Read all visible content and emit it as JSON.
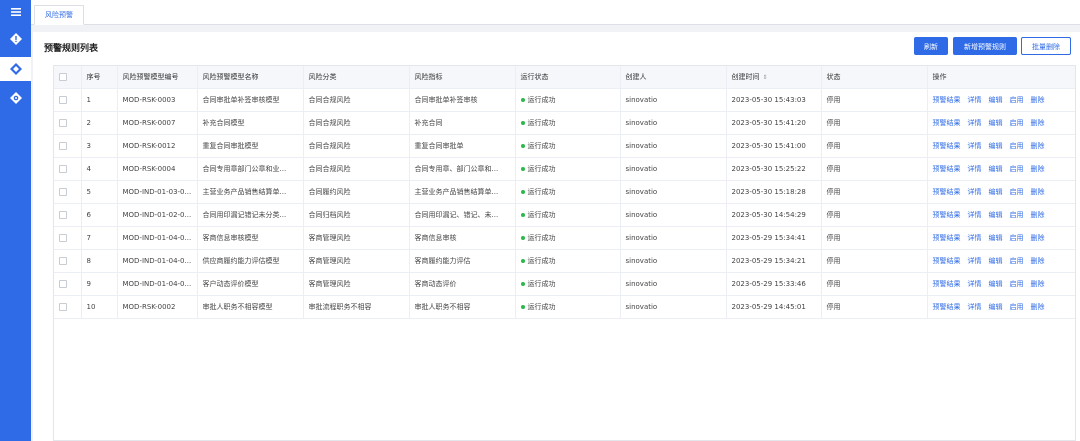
{
  "sidebar": {
    "icons": [
      "menu-icon",
      "warning-diamond-icon",
      "risk-diamond-icon",
      "settings-diamond-icon"
    ]
  },
  "tab": {
    "label": "风险预警"
  },
  "page": {
    "title": "预警规则列表",
    "buttons": {
      "refresh": "刷新",
      "add": "新增预警规则",
      "batch_delete": "批量删除"
    }
  },
  "table": {
    "headers": {
      "index": "序号",
      "code": "风险预警模型编号",
      "name": "风险预警模型名称",
      "category": "风险分类",
      "indicator": "风险指标",
      "run_status": "运行状态",
      "creator": "创建人",
      "created_at": "创建时间",
      "status": "状态",
      "actions": "操作"
    },
    "action_labels": [
      "预警结果",
      "详情",
      "编辑",
      "启用",
      "删除"
    ],
    "rows": [
      {
        "index": "1",
        "code": "MOD-RSK-0003",
        "name": "合同审批单补签审核模型",
        "category": "合同合规风险",
        "indicator": "合同审批单补签审核",
        "run_status": "运行成功",
        "creator": "sinovatio",
        "created_at": "2023-05-30 15:43:03",
        "status": "停用"
      },
      {
        "index": "2",
        "code": "MOD-RSK-0007",
        "name": "补充合同模型",
        "category": "合同合规风险",
        "indicator": "补充合同",
        "run_status": "运行成功",
        "creator": "sinovatio",
        "created_at": "2023-05-30 15:41:20",
        "status": "停用"
      },
      {
        "index": "3",
        "code": "MOD-RSK-0012",
        "name": "重复合同审批模型",
        "category": "合同合规风险",
        "indicator": "重复合同审批单",
        "run_status": "运行成功",
        "creator": "sinovatio",
        "created_at": "2023-05-30 15:41:00",
        "status": "停用"
      },
      {
        "index": "4",
        "code": "MOD-RSK-0004",
        "name": "合同专用章部门公章和业...",
        "category": "合同合规风险",
        "indicator": "合同专用章、部门公章和...",
        "run_status": "运行成功",
        "creator": "sinovatio",
        "created_at": "2023-05-30 15:25:22",
        "status": "停用"
      },
      {
        "index": "5",
        "code": "MOD-IND-01-03-0...",
        "name": "主营业务产品销售结算单...",
        "category": "合同履约风险",
        "indicator": "主营业务产品销售结算单...",
        "run_status": "运行成功",
        "creator": "sinovatio",
        "created_at": "2023-05-30 15:18:28",
        "status": "停用"
      },
      {
        "index": "6",
        "code": "MOD-IND-01-02-0...",
        "name": "合同用印漏记错记未分类...",
        "category": "合同归档风险",
        "indicator": "合同用印漏记、错记、未...",
        "run_status": "运行成功",
        "creator": "sinovatio",
        "created_at": "2023-05-30 14:54:29",
        "status": "停用"
      },
      {
        "index": "7",
        "code": "MOD-IND-01-04-0...",
        "name": "客商信息审核模型",
        "category": "客商管理风险",
        "indicator": "客商信息审核",
        "run_status": "运行成功",
        "creator": "sinovatio",
        "created_at": "2023-05-29 15:34:41",
        "status": "停用"
      },
      {
        "index": "8",
        "code": "MOD-IND-01-04-0...",
        "name": "供应商履约能力评估模型",
        "category": "客商管理风险",
        "indicator": "客商履约能力评估",
        "run_status": "运行成功",
        "creator": "sinovatio",
        "created_at": "2023-05-29 15:34:21",
        "status": "停用"
      },
      {
        "index": "9",
        "code": "MOD-IND-01-04-0...",
        "name": "客户动态评价模型",
        "category": "客商管理风险",
        "indicator": "客商动态评价",
        "run_status": "运行成功",
        "creator": "sinovatio",
        "created_at": "2023-05-29 15:33:46",
        "status": "停用"
      },
      {
        "index": "10",
        "code": "MOD-RSK-0002",
        "name": "审批人职务不相容模型",
        "category": "审批流程职务不相容",
        "indicator": "审批人职务不相容",
        "run_status": "运行成功",
        "creator": "sinovatio",
        "created_at": "2023-05-29 14:45:01",
        "status": "停用"
      }
    ]
  },
  "colors": {
    "primary": "#2f6be6",
    "success": "#2db84d"
  }
}
